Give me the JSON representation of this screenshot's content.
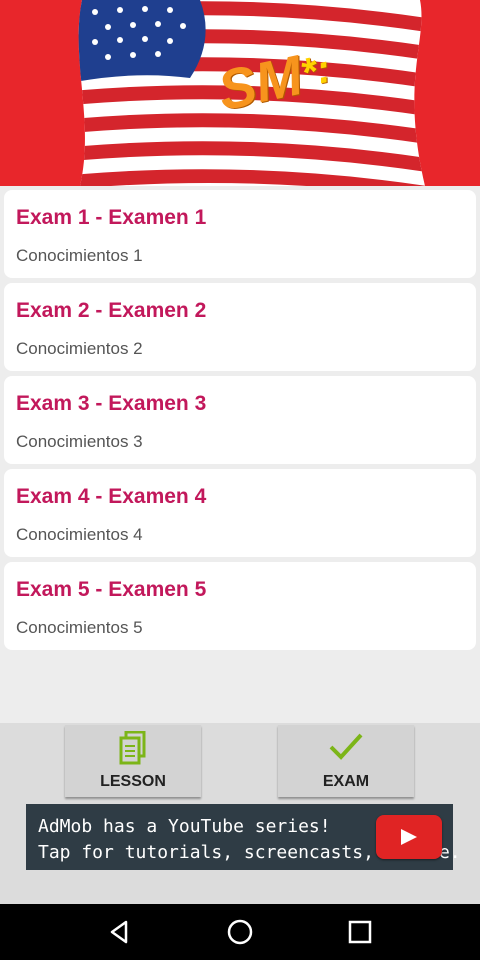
{
  "header": {
    "logo_text": "SM",
    "logo_mark": "*:",
    "brand_color": "#e8262b",
    "logo_color": "#f7941d"
  },
  "exams": [
    {
      "title": "Exam 1 - Examen 1",
      "subtitle": "Conocimientos 1"
    },
    {
      "title": "Exam 2 - Examen 2",
      "subtitle": "Conocimientos 2"
    },
    {
      "title": "Exam 3 - Examen 3",
      "subtitle": "Conocimientos 3"
    },
    {
      "title": "Exam 4 - Examen 4",
      "subtitle": "Conocimientos 4"
    },
    {
      "title": "Exam 5 - Examen 5",
      "subtitle": "Conocimientos 5"
    }
  ],
  "tabs": {
    "lesson": {
      "label": "LESSON",
      "icon": "document-copy-icon"
    },
    "exam": {
      "label": "EXAM",
      "icon": "checkmark-icon"
    }
  },
  "ad": {
    "line1": "AdMob has a YouTube series!",
    "line2": "Tap for tutorials, screencasts, & more.",
    "icon": "youtube-play-icon"
  },
  "nav": {
    "back_icon": "back-triangle-icon",
    "home_icon": "home-circle-icon",
    "recents_icon": "recents-square-icon"
  },
  "colors": {
    "title": "#c2185b",
    "accent_green": "#7cb518",
    "ad_bg": "#2f3c45",
    "play_red": "#e02424"
  }
}
